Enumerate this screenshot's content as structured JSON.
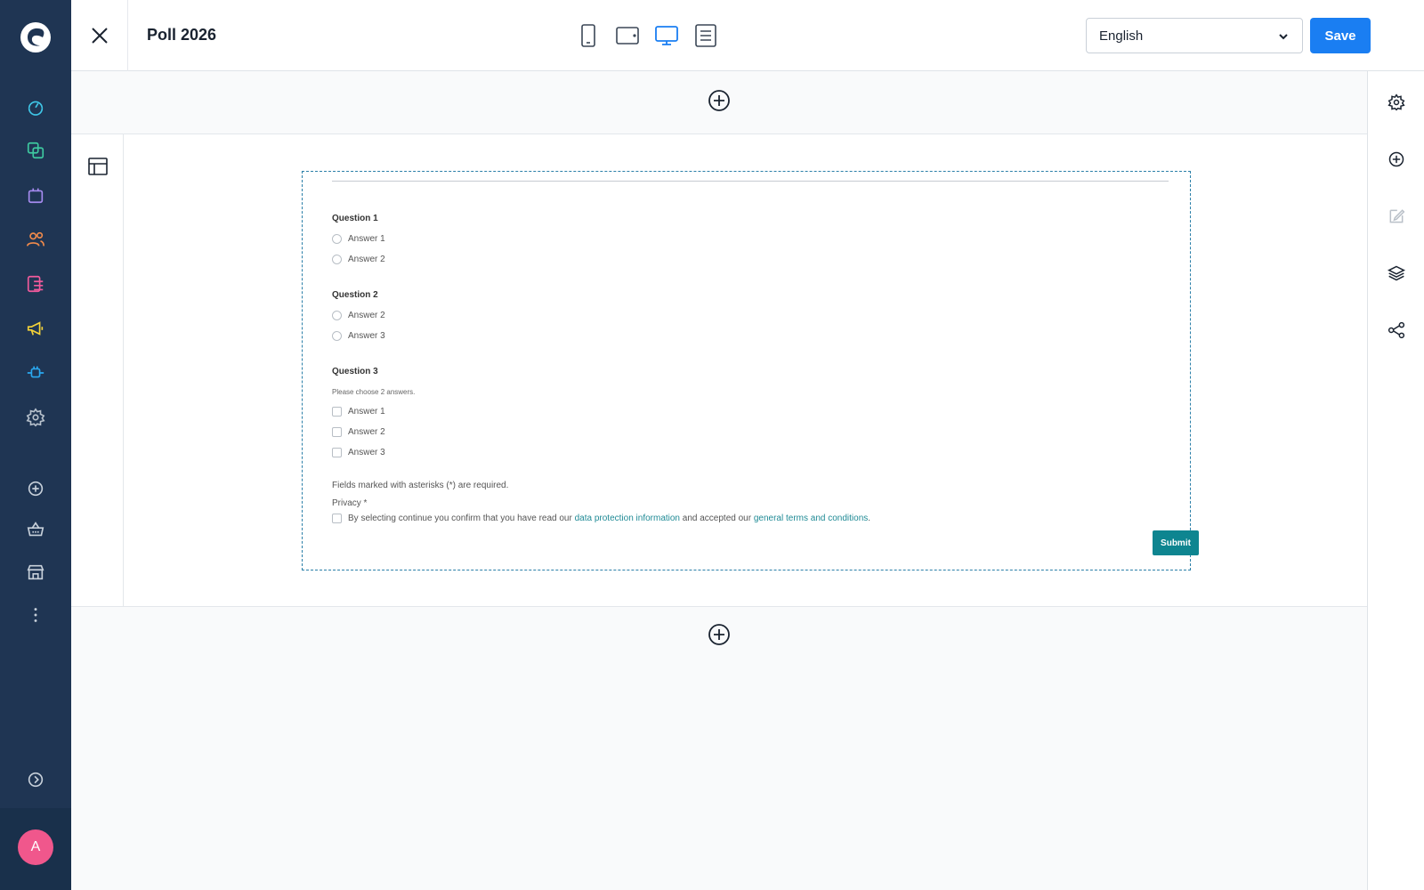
{
  "app": {
    "title": "Poll 2026"
  },
  "nav": {
    "items": [
      {
        "icon": "dashboard-icon",
        "color": "#3fc7e8"
      },
      {
        "icon": "catalogues-icon",
        "color": "#3ec9a0"
      },
      {
        "icon": "orders-icon",
        "color": "#a68bf0"
      },
      {
        "icon": "customers-icon",
        "color": "#f08a4b"
      },
      {
        "icon": "content-icon",
        "color": "#f05a9c"
      },
      {
        "icon": "marketing-icon",
        "color": "#f5d338"
      },
      {
        "icon": "extensions-icon",
        "color": "#2aa8f0"
      },
      {
        "icon": "settings-icon",
        "color": "#b7c1cc"
      }
    ],
    "secondary": [
      {
        "icon": "add-circle-icon"
      },
      {
        "icon": "basket-icon"
      },
      {
        "icon": "storefront-icon"
      },
      {
        "icon": "more-vertical-icon"
      }
    ],
    "avatar_initial": "A"
  },
  "toolbar": {
    "language": "English",
    "save_label": "Save",
    "active_device": "desktop"
  },
  "form": {
    "questions": [
      {
        "title": "Question 1",
        "type": "radio",
        "options": [
          "Answer 1",
          "Answer 2"
        ]
      },
      {
        "title": "Question 2",
        "type": "radio",
        "options": [
          "Answer 2",
          "Answer 3"
        ]
      },
      {
        "title": "Question 3",
        "type": "checkbox",
        "hint": "Please choose 2 answers.",
        "options": [
          "Answer 1",
          "Answer 2",
          "Answer 3"
        ]
      }
    ],
    "required_note": "Fields marked with asterisks (*) are required.",
    "privacy_label": "Privacy *",
    "privacy_text_1": "By selecting continue you confirm that you have read our ",
    "privacy_link_1": "data protection information",
    "privacy_text_2": " and accepted our ",
    "privacy_link_2": "general terms and conditions",
    "privacy_text_3": ".",
    "submit_label": "Submit"
  },
  "colors": {
    "sidebar_bg": "#1f3553",
    "primary": "#1a7ef2",
    "submit": "#0e8590",
    "link": "#1f8a95"
  }
}
